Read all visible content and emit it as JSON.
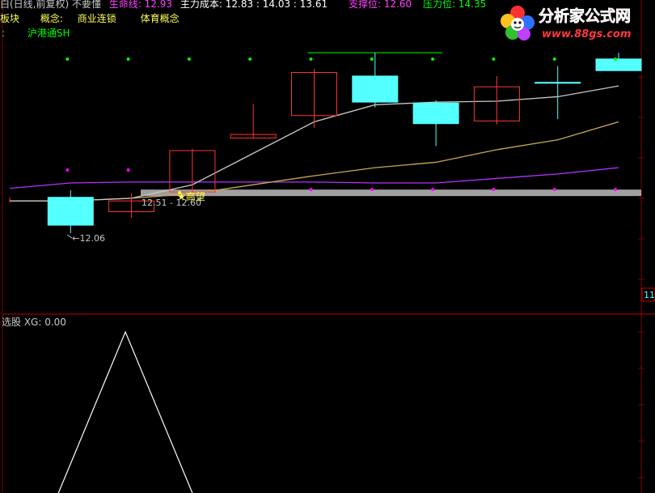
{
  "header": {
    "title": "白(日线,前复权) 不要懂",
    "lifeline_label": "生命线: 12.93",
    "cost_label": "主力成本: 12.83 : 14.03 : 13.61",
    "support_label": "支撑位: 12.60",
    "pressure_label": "压力位: 14.35"
  },
  "info_line": {
    "sector_label": "板块",
    "concept_label": "概念:",
    "concept_1": "商业连锁",
    "concept_2": "体育概念"
  },
  "connect_line": {
    "marker": ":",
    "label": "沪港通SH"
  },
  "logo": {
    "title": "分析家公式网",
    "url": "www.88gs.com"
  },
  "right_axis_label": "11",
  "sub_panel": {
    "title": "选股 XG: 0.00"
  },
  "colors": {
    "up_candle": "#ff3232",
    "down_candle": "#54ffff",
    "lifeline": "#c8c8c8",
    "cost_line": "#c8a850",
    "purple_line": "#b432ff",
    "support_band": "#a0a0a0",
    "dot_green": "#00ff00",
    "dot_magenta": "#ff00ff",
    "xg_line": "#ffffff",
    "grid": "#800000"
  },
  "chart_data": [
    {
      "type": "candlestick",
      "candles": [
        {
          "open": 12.4,
          "close": 12.46,
          "high": 12.46,
          "low": 12.4
        },
        {
          "open": 12.46,
          "close": 12.15,
          "high": 12.54,
          "low": 12.06
        },
        {
          "open": 12.3,
          "close": 12.42,
          "high": 12.5,
          "low": 12.23
        },
        {
          "open": 12.52,
          "close": 12.98,
          "high": 13.0,
          "low": 12.51
        },
        {
          "open": 13.12,
          "close": 13.16,
          "high": 13.5,
          "low": 13.12
        },
        {
          "open": 13.37,
          "close": 13.85,
          "high": 13.89,
          "low": 13.23
        },
        {
          "open": 13.81,
          "close": 13.52,
          "high": 14.07,
          "low": 13.46
        },
        {
          "open": 13.51,
          "close": 13.28,
          "high": 13.54,
          "low": 13.03
        },
        {
          "open": 13.31,
          "close": 13.69,
          "high": 13.81,
          "low": 13.27
        },
        {
          "open": 13.74,
          "close": 13.73,
          "high": 13.92,
          "low": 13.33
        },
        {
          "open": 14.0,
          "close": 13.87,
          "high": 14.07,
          "low": 13.87
        }
      ],
      "lifeline": [
        12.42,
        12.42,
        12.45,
        12.6,
        12.95,
        13.3,
        13.49,
        13.52,
        13.53,
        13.58,
        13.7
      ],
      "cost_line": [
        12.42,
        12.42,
        12.45,
        12.5,
        12.6,
        12.7,
        12.79,
        12.85,
        12.99,
        13.1,
        13.3
      ],
      "purple_line": [
        12.56,
        12.62,
        12.63,
        12.63,
        12.63,
        12.63,
        12.62,
        12.62,
        12.67,
        12.72,
        12.79
      ],
      "pressure_line": {
        "value": 14.07,
        "from": 5,
        "to": 7
      },
      "support_band": 12.51,
      "annotations": [
        {
          "text": "12.06",
          "index": 1,
          "value": 12.06
        },
        {
          "text": "12.51 - 12.60",
          "index": 3,
          "value": 12.51
        },
        {
          "text": "★高望",
          "index": 3,
          "value": 12.51
        }
      ],
      "green_dots": [
        1,
        2,
        3,
        4,
        5,
        6,
        7,
        8,
        9,
        10
      ],
      "magenta_dots": [
        1,
        2,
        5,
        6,
        7,
        8,
        9,
        10
      ],
      "ylim": [
        11.25,
        14.26
      ]
    },
    {
      "type": "line",
      "title": "选股 XG: 0.00",
      "x": [
        0.8,
        1.9,
        3.0
      ],
      "values": [
        0,
        1,
        0
      ],
      "ylim": [
        0,
        1
      ]
    }
  ]
}
